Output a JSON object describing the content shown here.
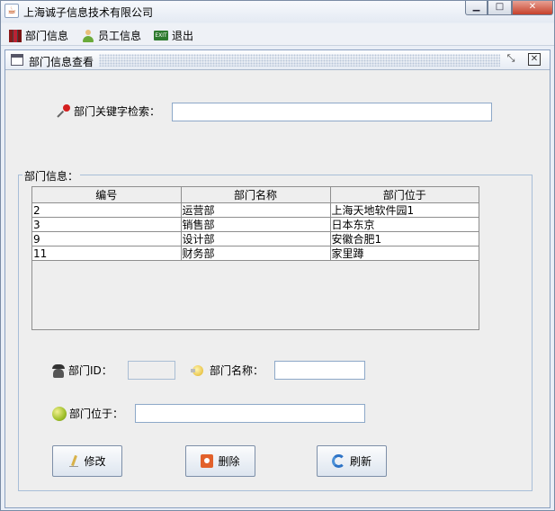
{
  "window": {
    "title": "上海诚子信息技术有限公司",
    "controls": {
      "minimize": "▁",
      "maximize": "□",
      "close": "✕"
    }
  },
  "menu": {
    "items": [
      {
        "label": "部门信息",
        "icon": "books-icon"
      },
      {
        "label": "员工信息",
        "icon": "user-icon"
      },
      {
        "label": "退出",
        "icon": "exit-icon",
        "icon_text": "EXIT"
      }
    ]
  },
  "frame": {
    "title": "部门信息查看",
    "controls": {
      "restore": "⤡",
      "close": "✕"
    }
  },
  "search": {
    "label": "部门关键字检索：",
    "value": ""
  },
  "group": {
    "title": "部门信息："
  },
  "table": {
    "headers": [
      "编号",
      "部门名称",
      "部门位于"
    ],
    "rows": [
      [
        "2",
        "运营部",
        "上海天地软件园1"
      ],
      [
        "3",
        "销售部",
        "日本东京"
      ],
      [
        "9",
        "设计部",
        "安徽合肥1"
      ],
      [
        "11",
        "财务部",
        "家里蹲"
      ]
    ]
  },
  "fields": {
    "dept_id_label": "部门ID：",
    "dept_id_value": "",
    "dept_name_label": "部门名称：",
    "dept_name_value": "",
    "dept_loc_label": "部门位于：",
    "dept_loc_value": ""
  },
  "buttons": {
    "edit": "修改",
    "delete": "删除",
    "refresh": "刷新"
  }
}
